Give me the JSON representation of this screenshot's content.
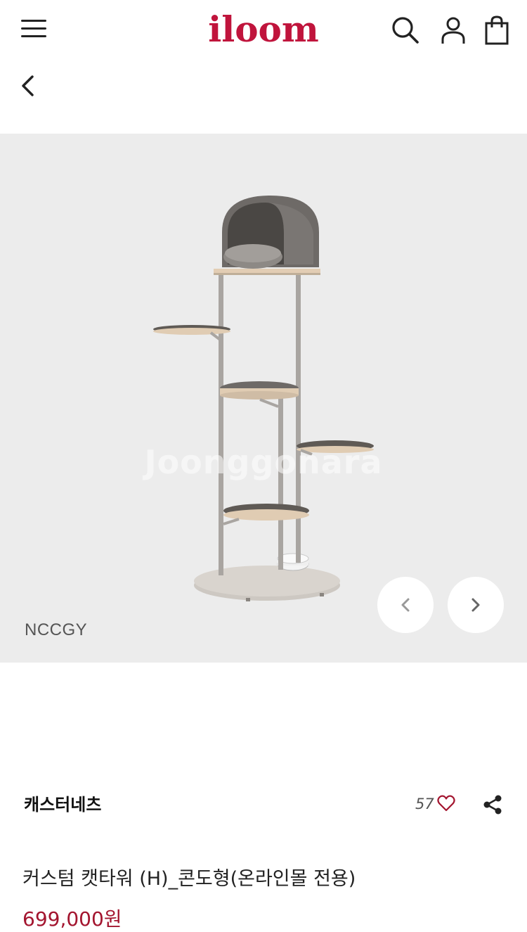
{
  "header": {
    "logo": "iloom",
    "icons": {
      "menu": "hamburger-menu-icon",
      "search": "search-icon",
      "account": "user-icon",
      "cart": "shopping-bag-icon",
      "back": "chevron-left-icon"
    }
  },
  "gallery": {
    "variant_code": "NCCGY",
    "watermark": "Joonggonara"
  },
  "product": {
    "brand": "캐스터네츠",
    "like_count": "57",
    "title": "커스텀 캣타워 (H)_콘도형(온라인몰 전용)",
    "price": "699,000원"
  },
  "colors": {
    "brand_red": "#c0143c",
    "price_red": "#a3152f",
    "gallery_bg": "#ececec"
  }
}
